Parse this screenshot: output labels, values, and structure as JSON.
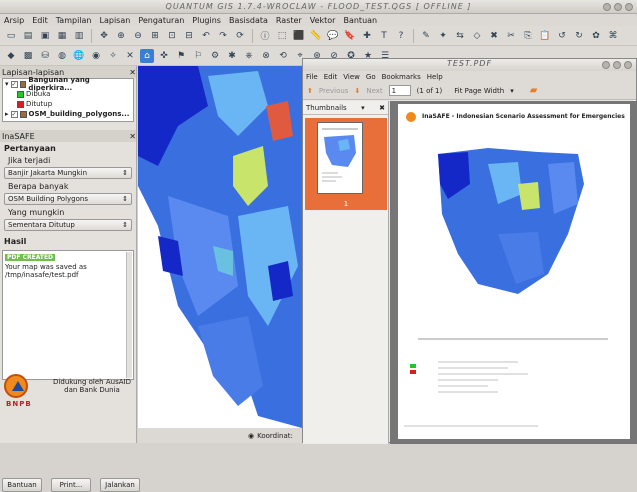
{
  "window": {
    "title": "QUANTUM GIS 1.7.4-WROCLAW - FLOOD_TEST.QGS  [ OFFLINE ]"
  },
  "menu": [
    "Arsip",
    "Edit",
    "Tampilan",
    "Lapisan",
    "Pengaturan",
    "Plugins",
    "Basisdata",
    "Raster",
    "Vektor",
    "Bantuan"
  ],
  "layers_panel": {
    "title": "Lapisan-lapisan",
    "layers": [
      {
        "name": "Bangunan yang diperkira..."
      },
      {
        "name": "OSM_building_polygons..."
      }
    ],
    "legend": [
      {
        "label": "Dibuka",
        "color": "#29c42a"
      },
      {
        "label": "Ditutup",
        "color": "#d62020"
      }
    ]
  },
  "inasafe": {
    "title": "InaSAFE",
    "questions_label": "Pertanyaan",
    "if_label": "Jika terjadi",
    "hazard_value": "Banjir Jakarta Mungkin",
    "how_many_label": "Berapa banyak",
    "exposure_value": "OSM Building Polygons",
    "which_label": "Yang mungkin",
    "function_value": "Sementara Ditutup",
    "result_label": "Hasil",
    "result_badge": "PDF CREATED",
    "result_text": "Your map was saved as /tmp/inasafe/test.pdf",
    "support_text": "Didukung oleh AusAID dan Bank Dunia",
    "logo_text": "BNPB",
    "buttons": {
      "help": "Bantuan",
      "print": "Print...",
      "run": "Jalankan"
    }
  },
  "statusbar": {
    "coordinate_label": "Koordinat:"
  },
  "pdf": {
    "title": "TEST.PDF",
    "menu": [
      "File",
      "Edit",
      "View",
      "Go",
      "Bookmarks",
      "Help"
    ],
    "previous": "Previous",
    "next": "Next",
    "page_number": "1",
    "page_count": "(1 of 1)",
    "zoom": "Fit Page Width",
    "thumbnails_label": "Thumbnails",
    "thumb_page_label": "1",
    "report_title": "InaSAFE - Indonesian Scenario Assessment for Emergencies"
  },
  "colors": {
    "accent_orange": "#e86f3a",
    "map_blue": "#3a6fe0",
    "map_dark_blue": "#1428c8",
    "map_light": "#6ab6f4",
    "map_yellow": "#c8e46a",
    "map_red": "#e05a40"
  }
}
